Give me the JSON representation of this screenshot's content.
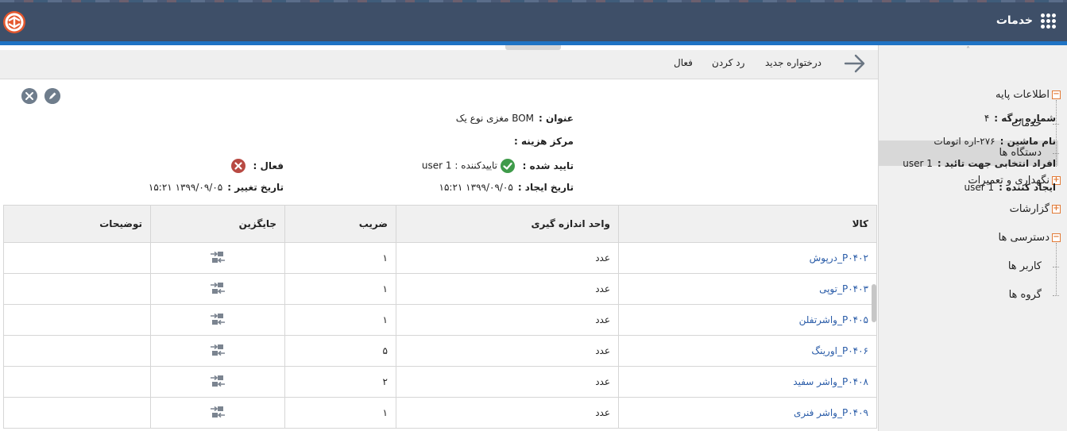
{
  "header": {
    "title": "خدمات",
    "icons": {
      "apps": "grid-icon",
      "logo": "brand-logo"
    }
  },
  "sidebar": {
    "items": [
      {
        "label": "اطلاعات پایه",
        "toggle": "−"
      },
      {
        "label": "خدمات"
      },
      {
        "label": "دستگاه ها",
        "selected": true
      },
      {
        "label": "نگهداری و تعمیرات",
        "toggle": "+"
      },
      {
        "label": "گزارشات",
        "toggle": "+"
      },
      {
        "label": "دسترسی ها",
        "toggle": "−"
      },
      {
        "label": "کاربر ها"
      },
      {
        "label": "گروه ها"
      }
    ]
  },
  "toolbar": {
    "new_request": "درختواره جدید",
    "reject": "رد کردن",
    "active": "فعال"
  },
  "details": {
    "sheet_no_label": "شماره برگه :",
    "sheet_no": "۴",
    "title_label": "عنوان :",
    "title": "BOM مغزی نوع یک",
    "machine_label": "نام ماشین :",
    "machine": "۲۷۶-اره اتومات",
    "cost_center_label": "مرکز هزینه :",
    "cost_center": "",
    "selected_people_label": "افراد انتخابی جهت تائید :",
    "selected_people": "user 1",
    "approved_label": "تایید شده :",
    "approver": "تاییدکننده : user 1",
    "active_label": "فعال :",
    "creator_label": "ایجاد کننده :",
    "creator": "user 1",
    "create_date_label": "تاریخ ایجاد :",
    "create_date": "۱۳۹۹/۰۹/۰۵ ۱۵:۲۱",
    "change_date_label": "تاریخ تغییر :",
    "change_date": "۱۳۹۹/۰۹/۰۵ ۱۵:۲۱"
  },
  "table": {
    "headers": [
      "کالا",
      "واحد اندازه گیری",
      "ضریب",
      "جایگزین",
      "توضیحات"
    ],
    "rows": [
      {
        "item": "P۰۴۰۲_درپوش",
        "unit": "عدد",
        "factor": "۱",
        "note": ""
      },
      {
        "item": "P۰۴۰۳_توپی",
        "unit": "عدد",
        "factor": "۱",
        "note": ""
      },
      {
        "item": "P۰۴۰۵_واشرتفلن",
        "unit": "عدد",
        "factor": "۱",
        "note": ""
      },
      {
        "item": "P۰۴۰۶_اورینگ",
        "unit": "عدد",
        "factor": "۵",
        "note": ""
      },
      {
        "item": "P۰۴۰۸_واشر سفید",
        "unit": "عدد",
        "factor": "۲",
        "note": ""
      },
      {
        "item": "P۰۴۰۹_واشر فنری",
        "unit": "عدد",
        "factor": "۱",
        "note": ""
      }
    ]
  },
  "colors": {
    "header_bg": "#3e4f68",
    "accent_blue": "#1f73c4",
    "link": "#2a5ca8",
    "ok": "#3f9b4a",
    "no": "#b84a43",
    "toggle": "#e27a36"
  }
}
